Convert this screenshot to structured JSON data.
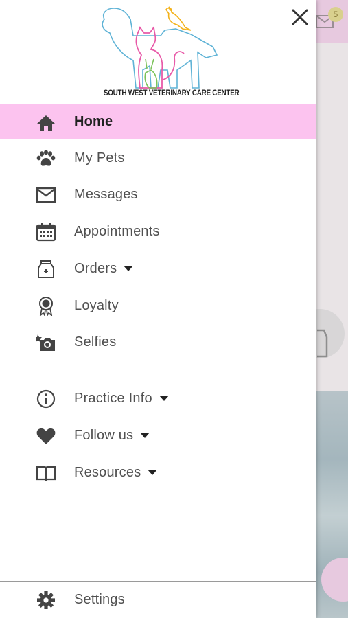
{
  "background_app": {
    "badge_count": "5",
    "colors": {
      "header": "#e7c9df",
      "badge": "#d9d08e"
    }
  },
  "drawer": {
    "logo_text": "SOUTH WEST VETERINARY CARE CENTER",
    "close_icon": "close-icon",
    "accent_color": "#fcc3ef",
    "menu": [
      {
        "label": "Home",
        "icon": "home-icon",
        "active": true
      },
      {
        "label": "My Pets",
        "icon": "paw-icon"
      },
      {
        "label": "Messages",
        "icon": "envelope-icon"
      },
      {
        "label": "Appointments",
        "icon": "calendar-icon"
      },
      {
        "label": "Orders",
        "icon": "food-bag-icon",
        "expandable": true
      },
      {
        "label": "Loyalty",
        "icon": "award-ribbon-icon"
      },
      {
        "label": "Selfies",
        "icon": "camera-icon"
      }
    ],
    "secondary_menu": [
      {
        "label": "Practice Info",
        "icon": "info-icon",
        "expandable": true
      },
      {
        "label": "Follow us",
        "icon": "heart-icon",
        "expandable": true
      },
      {
        "label": "Resources",
        "icon": "book-icon",
        "expandable": true
      }
    ],
    "footer": {
      "label": "Settings",
      "icon": "gear-icon"
    }
  }
}
